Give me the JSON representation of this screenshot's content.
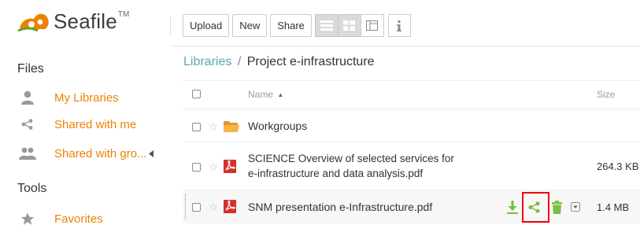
{
  "app": {
    "name": "Seafile",
    "trademark": "TM",
    "brand_color": "#eb8205"
  },
  "sidebar": {
    "files_heading": "Files",
    "items": [
      {
        "label": "My Libraries",
        "icon": "user-icon"
      },
      {
        "label": "Shared with me",
        "icon": "share-icon"
      },
      {
        "label": "Shared with gro...",
        "icon": "group-icon"
      }
    ],
    "tools_heading": "Tools",
    "tools_items": [
      {
        "label": "Favorites",
        "icon": "star-icon"
      }
    ]
  },
  "toolbar": {
    "upload_label": "Upload",
    "new_label": "New",
    "share_label": "Share",
    "view_modes": [
      "list-view-icon",
      "grid-view-icon",
      "column-view-icon"
    ],
    "active_view": "list-view-icon",
    "info_icon": "info-icon"
  },
  "breadcrumb": {
    "root": "Libraries",
    "separator": "/",
    "current": "Project e-infrastructure"
  },
  "table": {
    "headers": {
      "name": "Name",
      "sort_indicator": "▲",
      "size": "Size"
    },
    "rows": [
      {
        "name": "Workgroups",
        "type": "folder",
        "size": ""
      },
      {
        "name_line1": "SCIENCE Overview of selected services for",
        "name_line2": "e-infrastructure and data analysis.pdf",
        "type": "pdf",
        "size": "264.3 KB"
      },
      {
        "name": "SNM presentation e-Infrastructure.pdf",
        "type": "pdf",
        "size": "1.4 MB",
        "hovered": true
      }
    ],
    "row_ops": [
      "download-icon",
      "share-icon",
      "delete-icon",
      "more-dropdown-icon"
    ],
    "highlighted_op": "share-icon"
  },
  "colors": {
    "link": "#57a5b8",
    "op_green": "#76c043",
    "pdf_red": "#d6302c",
    "folder_orange": "#f4a82c",
    "highlight": "#ee0000"
  }
}
